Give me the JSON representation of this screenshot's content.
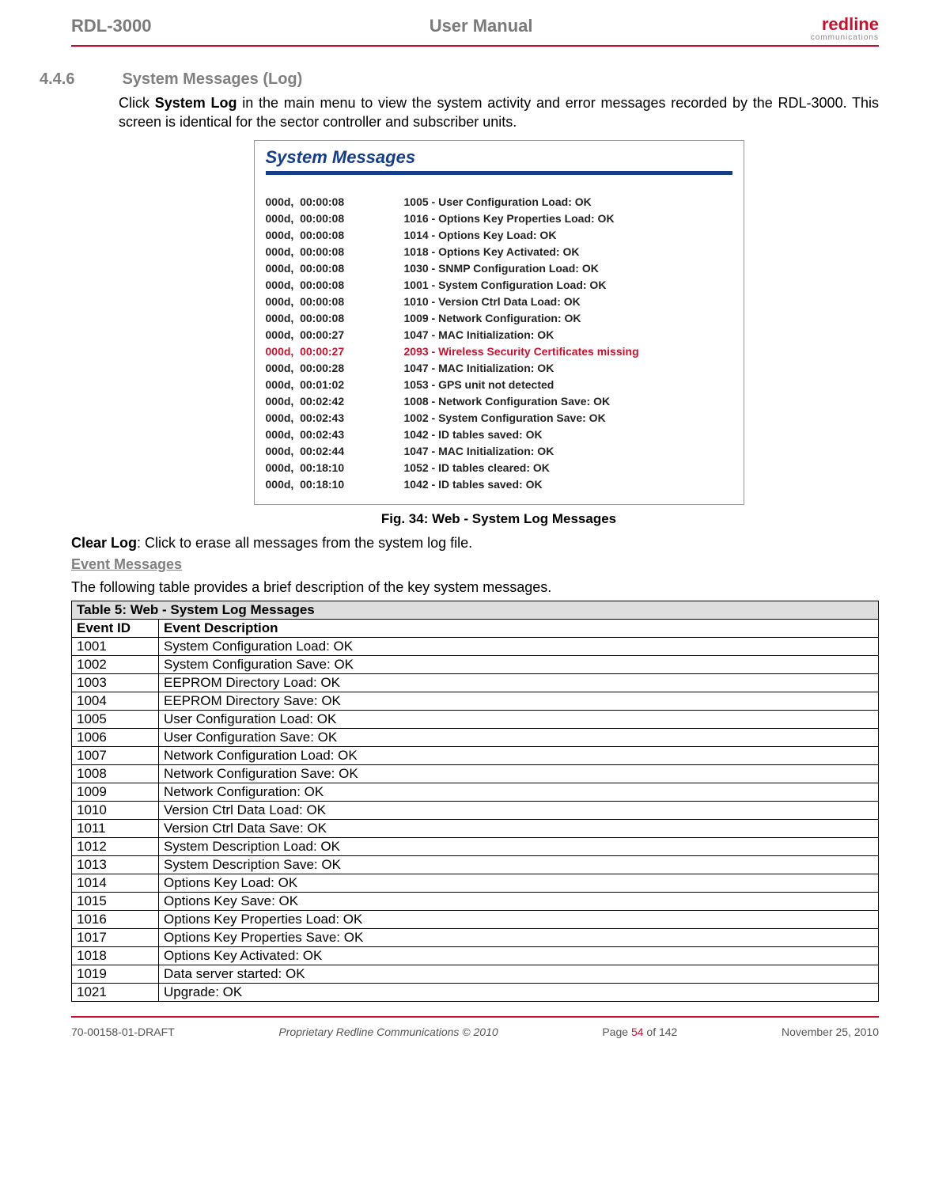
{
  "header": {
    "left": "RDL-3000",
    "center": "User Manual",
    "logo_main": "redline",
    "logo_sub": "communications"
  },
  "section": {
    "number": "4.4.6",
    "title": "System Messages (Log)"
  },
  "intro_prefix": "Click ",
  "intro_bold": "System Log",
  "intro_suffix": " in the main menu to view the system activity and error messages recorded by the RDL-3000. This screen is identical for the sector controller and subscriber units.",
  "screenshot": {
    "title": "System Messages",
    "rows": [
      {
        "time": "000d,  00:00:08",
        "msg": "1005 - User Configuration Load: OK",
        "err": false
      },
      {
        "time": "000d,  00:00:08",
        "msg": "1016 - Options Key Properties Load: OK",
        "err": false
      },
      {
        "time": "000d,  00:00:08",
        "msg": "1014 - Options Key Load: OK",
        "err": false
      },
      {
        "time": "000d,  00:00:08",
        "msg": "1018 - Options Key Activated: OK",
        "err": false
      },
      {
        "time": "000d,  00:00:08",
        "msg": "1030 - SNMP Configuration Load: OK",
        "err": false
      },
      {
        "time": "000d,  00:00:08",
        "msg": "1001 - System Configuration Load: OK",
        "err": false
      },
      {
        "time": "000d,  00:00:08",
        "msg": "1010 - Version Ctrl Data Load: OK",
        "err": false
      },
      {
        "time": "000d,  00:00:08",
        "msg": "1009 - Network Configuration: OK",
        "err": false
      },
      {
        "time": "000d,  00:00:27",
        "msg": "1047 - MAC Initialization: OK",
        "err": false
      },
      {
        "time": "000d,  00:00:27",
        "msg": "2093 - Wireless Security Certificates missing",
        "err": true
      },
      {
        "time": "000d,  00:00:28",
        "msg": "1047 - MAC Initialization: OK",
        "err": false
      },
      {
        "time": "000d,  00:01:02",
        "msg": "1053 - GPS unit not detected",
        "err": false
      },
      {
        "time": "000d,  00:02:42",
        "msg": "1008 - Network Configuration Save: OK",
        "err": false
      },
      {
        "time": "000d,  00:02:43",
        "msg": "1002 - System Configuration Save: OK",
        "err": false
      },
      {
        "time": "000d,  00:02:43",
        "msg": "1042 - ID tables saved: OK",
        "err": false
      },
      {
        "time": "000d,  00:02:44",
        "msg": "1047 - MAC Initialization: OK",
        "err": false
      },
      {
        "time": "000d,  00:18:10",
        "msg": "1052 - ID tables cleared: OK",
        "err": false
      },
      {
        "time": "000d,  00:18:10",
        "msg": "1042 - ID tables saved: OK",
        "err": false
      }
    ]
  },
  "figure_caption": "Fig. 34: Web - System Log Messages",
  "clear_log_bold": "Clear Log",
  "clear_log_text": ": Click to erase all messages from the system log file.",
  "event_messages_heading": "Event Messages",
  "event_intro": "The following table provides a brief description of the key system messages.",
  "table": {
    "title": "Table 5: Web - System Log Messages",
    "col1": "Event ID",
    "col2": "Event Description",
    "rows": [
      {
        "id": "1001",
        "desc": "System Configuration Load: OK"
      },
      {
        "id": "1002",
        "desc": "System Configuration Save: OK"
      },
      {
        "id": "1003",
        "desc": "EEPROM Directory Load: OK"
      },
      {
        "id": "1004",
        "desc": "EEPROM Directory Save: OK"
      },
      {
        "id": "1005",
        "desc": "User Configuration Load: OK"
      },
      {
        "id": "1006",
        "desc": "User Configuration Save: OK"
      },
      {
        "id": "1007",
        "desc": "Network Configuration Load: OK"
      },
      {
        "id": "1008",
        "desc": "Network Configuration Save: OK"
      },
      {
        "id": "1009",
        "desc": "Network Configuration: OK"
      },
      {
        "id": "1010",
        "desc": "Version Ctrl Data Load: OK"
      },
      {
        "id": "1011",
        "desc": "Version Ctrl Data Save: OK"
      },
      {
        "id": "1012",
        "desc": "System Description Load: OK"
      },
      {
        "id": "1013",
        "desc": "System Description Save: OK"
      },
      {
        "id": "1014",
        "desc": "Options Key Load: OK"
      },
      {
        "id": "1015",
        "desc": "Options Key Save: OK"
      },
      {
        "id": "1016",
        "desc": "Options Key Properties Load: OK"
      },
      {
        "id": "1017",
        "desc": "Options Key Properties Save: OK"
      },
      {
        "id": "1018",
        "desc": "Options Key Activated: OK"
      },
      {
        "id": "1019",
        "desc": "Data server started: OK"
      },
      {
        "id": "1021",
        "desc": "Upgrade: OK"
      }
    ]
  },
  "footer": {
    "doc_id": "70-00158-01-DRAFT",
    "copyright": "Proprietary Redline Communications © 2010",
    "page_prefix": "Page ",
    "page_current": "54",
    "page_suffix": " of 142",
    "date": "November 25, 2010"
  }
}
